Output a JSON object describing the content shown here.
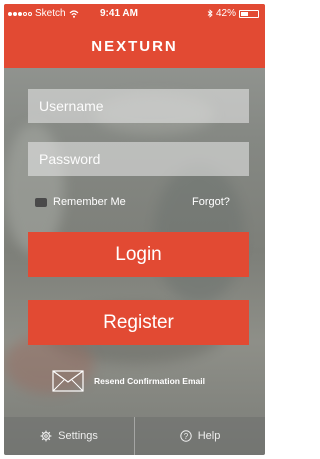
{
  "status_bar": {
    "carrier": "Sketch",
    "time": "9:41 AM",
    "battery": "42%",
    "battery_level": 0.42
  },
  "header": {
    "title": "NEXTURN"
  },
  "login_form": {
    "username_placeholder": "Username",
    "password_placeholder": "Password",
    "remember_label": "Remember Me",
    "forgot_label": "Forgot?",
    "login_label": "Login",
    "register_label": "Register"
  },
  "resend": {
    "label": "Resend Confirmation Email"
  },
  "footer": {
    "settings_label": "Settings",
    "help_label": "Help"
  },
  "colors": {
    "accent": "#e24a33"
  }
}
